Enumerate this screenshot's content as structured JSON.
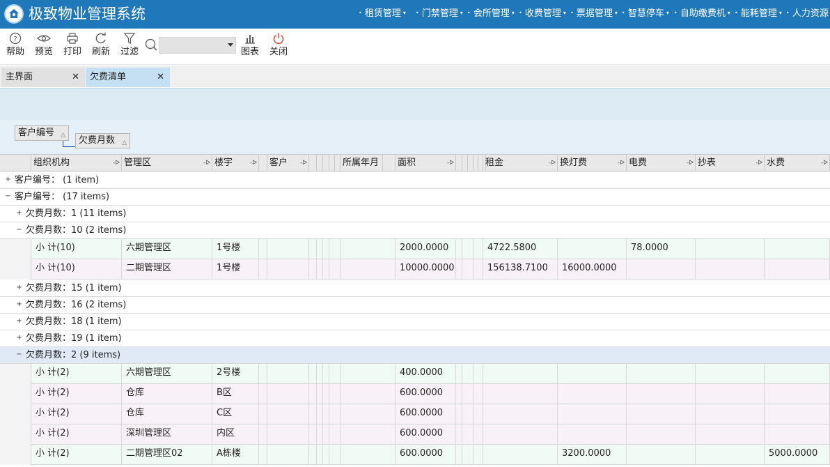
{
  "app": {
    "title": "极致物业管理系统"
  },
  "nav": [
    {
      "label": "租赁管理"
    },
    {
      "label": "门禁管理"
    },
    {
      "label": "会所管理"
    },
    {
      "label": "收费管理"
    },
    {
      "label": "票据管理"
    },
    {
      "label": "智慧停车"
    },
    {
      "label": "自助缴费机"
    },
    {
      "label": "能耗管理"
    },
    {
      "label": "人力资源"
    }
  ],
  "toolbar": {
    "help": "帮助",
    "preview": "预览",
    "print": "打印",
    "refresh": "刷新",
    "filter": "过滤",
    "chart": "图表",
    "close": "关闭",
    "search_value": ""
  },
  "tabs": [
    {
      "label": "主界面"
    },
    {
      "label": "欠费清单"
    }
  ],
  "group_panel": {
    "chips": [
      {
        "label": "客户编号"
      },
      {
        "label": "欠费月数"
      }
    ]
  },
  "columns": [
    "组织机构",
    "管理区",
    "楼宇",
    "",
    "客户",
    "",
    "",
    "",
    "",
    "",
    "所属年月",
    "",
    "面积",
    "",
    "",
    "",
    "",
    "",
    "",
    "租金",
    "",
    "换灯费",
    "电费",
    "抄表",
    "水费"
  ],
  "groups": [
    {
      "label": "客户编号：",
      "count": "(1 item)",
      "expanded": false
    },
    {
      "label": "客户编号：",
      "count": "(17 items)",
      "expanded": true
    }
  ],
  "subgroups": [
    {
      "label": "欠费月数：1",
      "count": "(11 items)",
      "expanded": false
    },
    {
      "label": "欠费月数：10",
      "count": "(2 items)",
      "expanded": true
    },
    {
      "label": "欠费月数：15",
      "count": "(1 item)",
      "expanded": false
    },
    {
      "label": "欠费月数：16",
      "count": "(2 items)",
      "expanded": false
    },
    {
      "label": "欠费月数：18",
      "count": "(1 item)",
      "expanded": false
    },
    {
      "label": "欠费月数：19",
      "count": "(1 item)",
      "expanded": false
    },
    {
      "label": "欠费月数：2",
      "count": "(9 items)",
      "expanded": true
    }
  ],
  "rows_10": [
    {
      "org": "小 计(10)",
      "area": "六期管理区",
      "building": "1号楼",
      "size": "2000.0000",
      "rent": "4722.5800",
      "lamp": "",
      "elec": "78.0000",
      "meter": "",
      "water": ""
    },
    {
      "org": "小 计(10)",
      "area": "二期管理区",
      "building": "1号楼",
      "size": "10000.0000",
      "rent": "156138.7100",
      "lamp": "16000.0000",
      "elec": "",
      "meter": "",
      "water": ""
    }
  ],
  "rows_2": [
    {
      "org": "小 计(2)",
      "area": "六期管理区",
      "building": "2号楼",
      "size": "400.0000",
      "rent": "",
      "lamp": "",
      "elec": "",
      "meter": "",
      "water": ""
    },
    {
      "org": "小 计(2)",
      "area": "仓库",
      "building": "B区",
      "size": "600.0000",
      "rent": "",
      "lamp": "",
      "elec": "",
      "meter": "",
      "water": ""
    },
    {
      "org": "小 计(2)",
      "area": "仓库",
      "building": "C区",
      "size": "600.0000",
      "rent": "",
      "lamp": "",
      "elec": "",
      "meter": "",
      "water": ""
    },
    {
      "org": "小 计(2)",
      "area": "深圳管理区",
      "building": "内区",
      "size": "600.0000",
      "rent": "",
      "lamp": "",
      "elec": "",
      "meter": "",
      "water": ""
    },
    {
      "org": "小 计(2)",
      "area": "二期管理区02",
      "building": "A栋楼",
      "size": "600.0000",
      "rent": "",
      "lamp": "3200.0000",
      "elec": "",
      "meter": "",
      "water": "5000.0000"
    }
  ],
  "colors": {
    "header_blue": "#1f78b9",
    "active_tab": "#c5dff3",
    "band": "#dceaf4",
    "row_even": "#f1fbf6",
    "row_odd": "#f8f1f7",
    "group_highlight": "#dfeaf6"
  }
}
